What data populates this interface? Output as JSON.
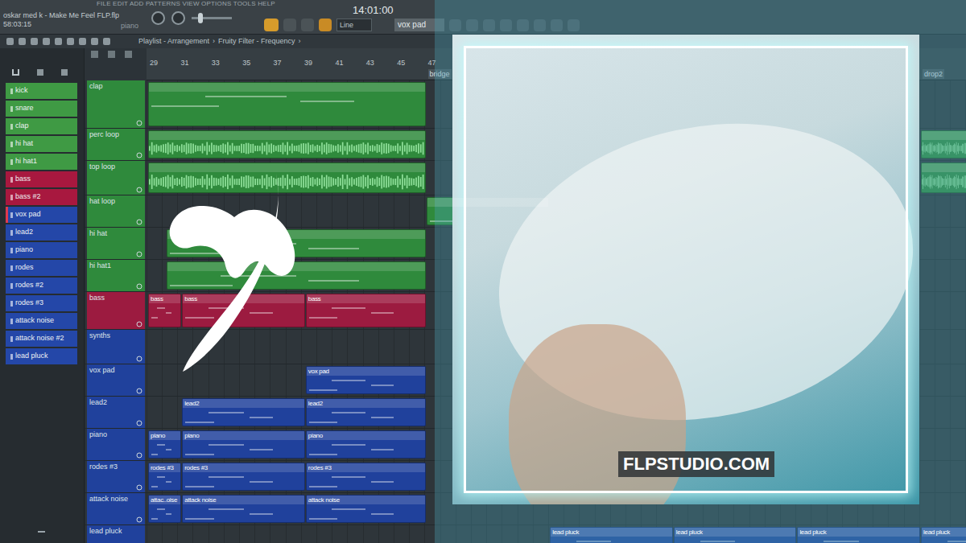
{
  "menu": "FILE EDIT ADD PATTERNS VIEW OPTIONS TOOLS HELP",
  "project": {
    "title": "oskar med k - Make Me Feel FLP.flp",
    "time": "58:03:15",
    "hint": "piano"
  },
  "toolbar": {
    "song_time": "14:01:00",
    "snap": "Line",
    "pattern": "vox pad"
  },
  "breadcrumb": {
    "items": [
      "Playlist - Arrangement",
      "Fruity Filter - Frequency"
    ],
    "separator": "›"
  },
  "channels": [
    {
      "name": "kick",
      "color": "#3f9a44",
      "selected": false
    },
    {
      "name": "snare",
      "color": "#3f9a44",
      "selected": false
    },
    {
      "name": "clap",
      "color": "#3f9a44",
      "selected": false
    },
    {
      "name": "hi hat",
      "color": "#3f9a44",
      "selected": false
    },
    {
      "name": "hi hat1",
      "color": "#3f9a44",
      "selected": false
    },
    {
      "name": "bass",
      "color": "#a8183f",
      "selected": false
    },
    {
      "name": "bass #2",
      "color": "#a8183f",
      "selected": false
    },
    {
      "name": "vox pad",
      "color": "#2447a8",
      "selected": true
    },
    {
      "name": "lead2",
      "color": "#2447a8",
      "selected": false
    },
    {
      "name": "piano",
      "color": "#2447a8",
      "selected": false
    },
    {
      "name": "rodes",
      "color": "#2447a8",
      "selected": false
    },
    {
      "name": "rodes #2",
      "color": "#2447a8",
      "selected": false
    },
    {
      "name": "rodes #3",
      "color": "#2447a8",
      "selected": false
    },
    {
      "name": "attack noise",
      "color": "#2447a8",
      "selected": false
    },
    {
      "name": "attack noise #2",
      "color": "#2447a8",
      "selected": false
    },
    {
      "name": "lead pluck",
      "color": "#2447a8",
      "selected": false
    }
  ],
  "ruler": {
    "bars": [
      "29",
      "31",
      "33",
      "35",
      "37",
      "39",
      "41",
      "43",
      "45",
      "47"
    ],
    "markers": [
      {
        "label": "bridge",
        "bar": 47
      },
      {
        "label": "drop2",
        "bar": 79
      }
    ]
  },
  "tracks": [
    {
      "name": "clap",
      "color": "#2f8a3c",
      "kind": "pattern",
      "clips": [
        {
          "label": "",
          "start": 29,
          "length": 18
        }
      ]
    },
    {
      "name": "perc loop",
      "color": "#2f8a3c",
      "kind": "audio",
      "clips": [
        {
          "label": "",
          "start": 29,
          "length": 18
        },
        {
          "label": "",
          "start": 79,
          "length": 8
        }
      ]
    },
    {
      "name": "top loop",
      "color": "#2f8a3c",
      "kind": "audio",
      "clips": [
        {
          "label": "",
          "start": 29,
          "length": 18
        },
        {
          "label": "",
          "start": 79,
          "length": 8
        }
      ]
    },
    {
      "name": "hat loop",
      "color": "#2f8a3c",
      "kind": "pattern",
      "clips": [
        {
          "label": "",
          "start": 47,
          "length": 8
        }
      ]
    },
    {
      "name": "hi hat",
      "color": "#2f8a3c",
      "kind": "pattern",
      "clips": [
        {
          "label": "",
          "start": 30.2,
          "length": 16.8
        }
      ]
    },
    {
      "name": "hi hat1",
      "color": "#2f8a3c",
      "kind": "pattern",
      "clips": [
        {
          "label": "",
          "start": 30.2,
          "length": 16.8
        }
      ]
    },
    {
      "name": "bass",
      "color": "#9c1b40",
      "kind": "pattern",
      "clips": [
        {
          "label": "bass",
          "start": 29,
          "length": 2.2
        },
        {
          "label": "bass",
          "start": 31.2,
          "length": 8
        },
        {
          "label": "bass",
          "start": 39.2,
          "length": 7.8
        }
      ]
    },
    {
      "name": "synths",
      "color": "#20419c",
      "kind": "pattern",
      "clips": []
    },
    {
      "name": "vox pad",
      "color": "#20419c",
      "kind": "pattern",
      "clips": [
        {
          "label": "vox pad",
          "start": 39.2,
          "length": 7.8
        }
      ]
    },
    {
      "name": "lead2",
      "color": "#20419c",
      "kind": "pattern",
      "clips": [
        {
          "label": "lead2",
          "start": 31.2,
          "length": 8
        },
        {
          "label": "lead2",
          "start": 39.2,
          "length": 7.8
        }
      ]
    },
    {
      "name": "piano",
      "color": "#20419c",
      "kind": "pattern",
      "clips": [
        {
          "label": "piano",
          "start": 29,
          "length": 2.2
        },
        {
          "label": "piano",
          "start": 31.2,
          "length": 8
        },
        {
          "label": "piano",
          "start": 39.2,
          "length": 7.8
        }
      ]
    },
    {
      "name": "rodes #3",
      "color": "#20419c",
      "kind": "pattern",
      "clips": [
        {
          "label": "rodes #3",
          "start": 29,
          "length": 2.2
        },
        {
          "label": "rodes #3",
          "start": 31.2,
          "length": 8
        },
        {
          "label": "rodes #3",
          "start": 39.2,
          "length": 7.8
        }
      ]
    },
    {
      "name": "attack noise",
      "color": "#20419c",
      "kind": "pattern",
      "clips": [
        {
          "label": "attac..oise",
          "start": 29,
          "length": 2.2
        },
        {
          "label": "attack noise",
          "start": 31.2,
          "length": 8
        },
        {
          "label": "attack noise",
          "start": 39.2,
          "length": 7.8
        }
      ]
    },
    {
      "name": "lead pluck",
      "color": "#20419c",
      "kind": "pattern",
      "clips": [
        {
          "label": "lead pluck",
          "start": 55,
          "length": 8
        },
        {
          "label": "lead pluck",
          "start": 63,
          "length": 8
        },
        {
          "label": "lead pluck",
          "start": 71,
          "length": 8
        },
        {
          "label": "lead pluck",
          "start": 79,
          "length": 8
        }
      ]
    }
  ],
  "overlay": {
    "watermark": "FLPSTUDIO.COM"
  }
}
